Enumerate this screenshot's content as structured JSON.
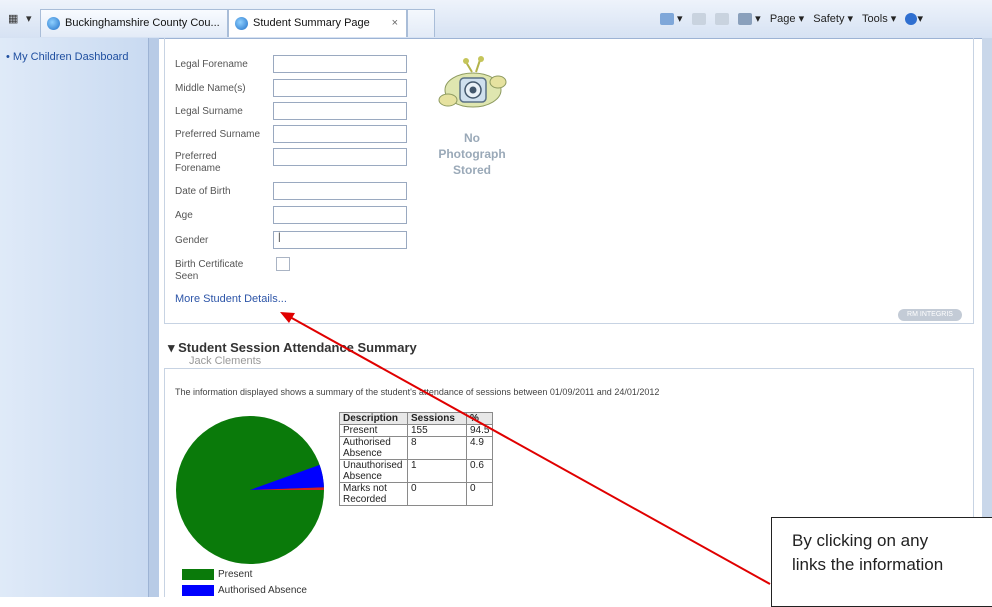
{
  "browser": {
    "tabs": [
      {
        "label": "Buckinghamshire County Cou...",
        "active": false
      },
      {
        "label": "Student Summary Page",
        "active": true
      }
    ],
    "tab_close": "×",
    "commands": {
      "page": "Page ▾",
      "safety": "Safety ▾",
      "tools": "Tools ▾",
      "help": "▾"
    }
  },
  "sidebar": {
    "items": [
      {
        "label": "• My Children Dashboard"
      }
    ]
  },
  "student": {
    "fields": [
      {
        "label": "Legal Forename",
        "value": ""
      },
      {
        "label": "Middle Name(s)",
        "value": ""
      },
      {
        "label": "Legal Surname",
        "value": ""
      },
      {
        "label": "Preferred Surname",
        "value": ""
      },
      {
        "label": "Preferred Forename",
        "value": ""
      },
      {
        "label": "Date of Birth",
        "value": ""
      },
      {
        "label": "Age",
        "value": ""
      },
      {
        "label": "Gender",
        "value": "|"
      }
    ],
    "birth_certificate_label": "Birth Certificate Seen",
    "more_link": "More Student Details...",
    "photo_text": "No Photograph Stored",
    "badge": "RM INTEGRIS"
  },
  "attendance": {
    "title": "▾ Student Session Attendance Summary",
    "student_name": "Jack Clements",
    "info": "The information displayed shows a summary of the student's attendance of sessions between 01/09/2011 and 24/01/2012",
    "headers": [
      "Description",
      "Sessions",
      "%"
    ],
    "rows": [
      {
        "description": "Present",
        "sessions": "155",
        "percent": "94.5"
      },
      {
        "description": "Authorised Absence",
        "sessions": "8",
        "percent": "4.9"
      },
      {
        "description": "Unauthorised Absence",
        "sessions": "1",
        "percent": "0.6"
      },
      {
        "description": "Marks not Recorded",
        "sessions": "0",
        "percent": "0"
      }
    ],
    "legend": [
      {
        "label": "Present",
        "color": "#0a7a0a"
      },
      {
        "label": "Authorised Absence",
        "color": "#0000ff"
      }
    ],
    "pie_colors": {
      "present": "#0a7a0a",
      "authorised": "#0000ff",
      "unauthorised": "#d42020"
    }
  },
  "callout": {
    "line1": "By clicking on any",
    "line2": "links the information"
  },
  "annotation_color": "#e00000"
}
